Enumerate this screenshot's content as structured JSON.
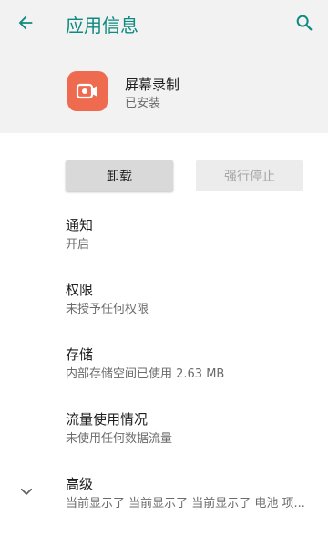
{
  "topbar": {
    "title": "应用信息",
    "back_icon": "arrow-back-icon",
    "search_icon": "search-icon"
  },
  "app": {
    "name": "屏幕录制",
    "status": "已安装",
    "icon_color": "#ef6b4f"
  },
  "buttons": {
    "uninstall": "卸载",
    "force_stop": "强行停止"
  },
  "settings": [
    {
      "title": "通知",
      "subtitle": "开启"
    },
    {
      "title": "权限",
      "subtitle": "未授予任何权限"
    },
    {
      "title": "存储",
      "subtitle": "内部存储空间已使用 2.63 MB"
    },
    {
      "title": "流量使用情况",
      "subtitle": "未使用任何数据流量"
    },
    {
      "title": "高级",
      "subtitle": "当前显示了 当前显示了 当前显示了 电池 项..."
    }
  ],
  "colors": {
    "accent": "#0f8a80",
    "header_bg": "#f2f2f2"
  }
}
